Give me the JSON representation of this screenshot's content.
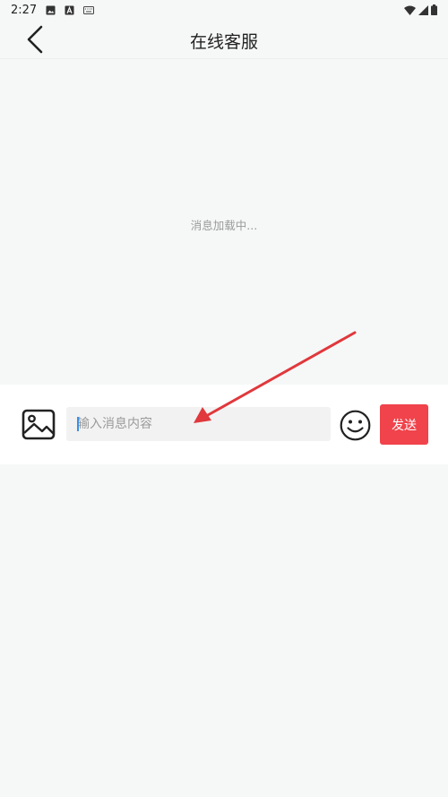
{
  "status_bar": {
    "time": "2:27",
    "left_icons": [
      "image-icon",
      "font-a-icon",
      "keyboard-icon"
    ],
    "right_icons": [
      "wifi-icon",
      "signal-icon",
      "battery-icon"
    ]
  },
  "header": {
    "title": "在线客服",
    "back_icon": "chevron-left-icon"
  },
  "messages": {
    "loading_text": "消息加载中..."
  },
  "input_bar": {
    "image_icon": "picture-icon",
    "placeholder": "输入消息内容",
    "value": "",
    "emoji_icon": "smiley-icon",
    "send_label": "发送"
  },
  "colors": {
    "background": "#f6f7f7",
    "send_button": "#f0434b",
    "annotation_arrow": "#e0383c",
    "caret": "#3a8fe8"
  }
}
